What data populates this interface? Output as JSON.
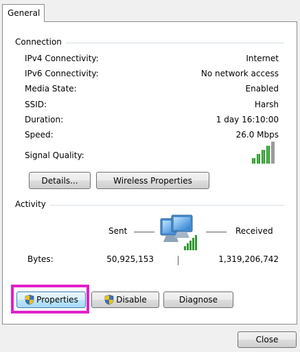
{
  "tabs": {
    "general": "General"
  },
  "connection": {
    "title": "Connection",
    "rows": [
      {
        "label": "IPv4 Connectivity:",
        "value": "Internet"
      },
      {
        "label": "IPv6 Connectivity:",
        "value": "No network access"
      },
      {
        "label": "Media State:",
        "value": "Enabled"
      },
      {
        "label": "SSID:",
        "value": "Harsh"
      },
      {
        "label": "Duration:",
        "value": "1 day 16:10:00"
      },
      {
        "label": "Speed:",
        "value": "26.0 Mbps"
      }
    ],
    "signal_label": "Signal Quality:",
    "signal_bars_filled": 5,
    "signal_bars_total": 5,
    "details_button": "Details...",
    "wireless_button": "Wireless Properties"
  },
  "activity": {
    "title": "Activity",
    "sent_label": "Sent",
    "received_label": "Received",
    "bytes_label": "Bytes:",
    "bytes_sent": "50,925,153",
    "bytes_received": "1,319,206,742"
  },
  "buttons": {
    "properties": "Properties",
    "disable": "Disable",
    "diagnose": "Diagnose",
    "close": "Close"
  },
  "colors": {
    "highlight": "#e020c8",
    "signal_green": "#2f9a2f",
    "accent_blue": "#3c7fb1"
  },
  "icons": {
    "signal": "signal-strength-icon",
    "network": "network-computers-icon",
    "shield": "uac-shield-icon"
  }
}
